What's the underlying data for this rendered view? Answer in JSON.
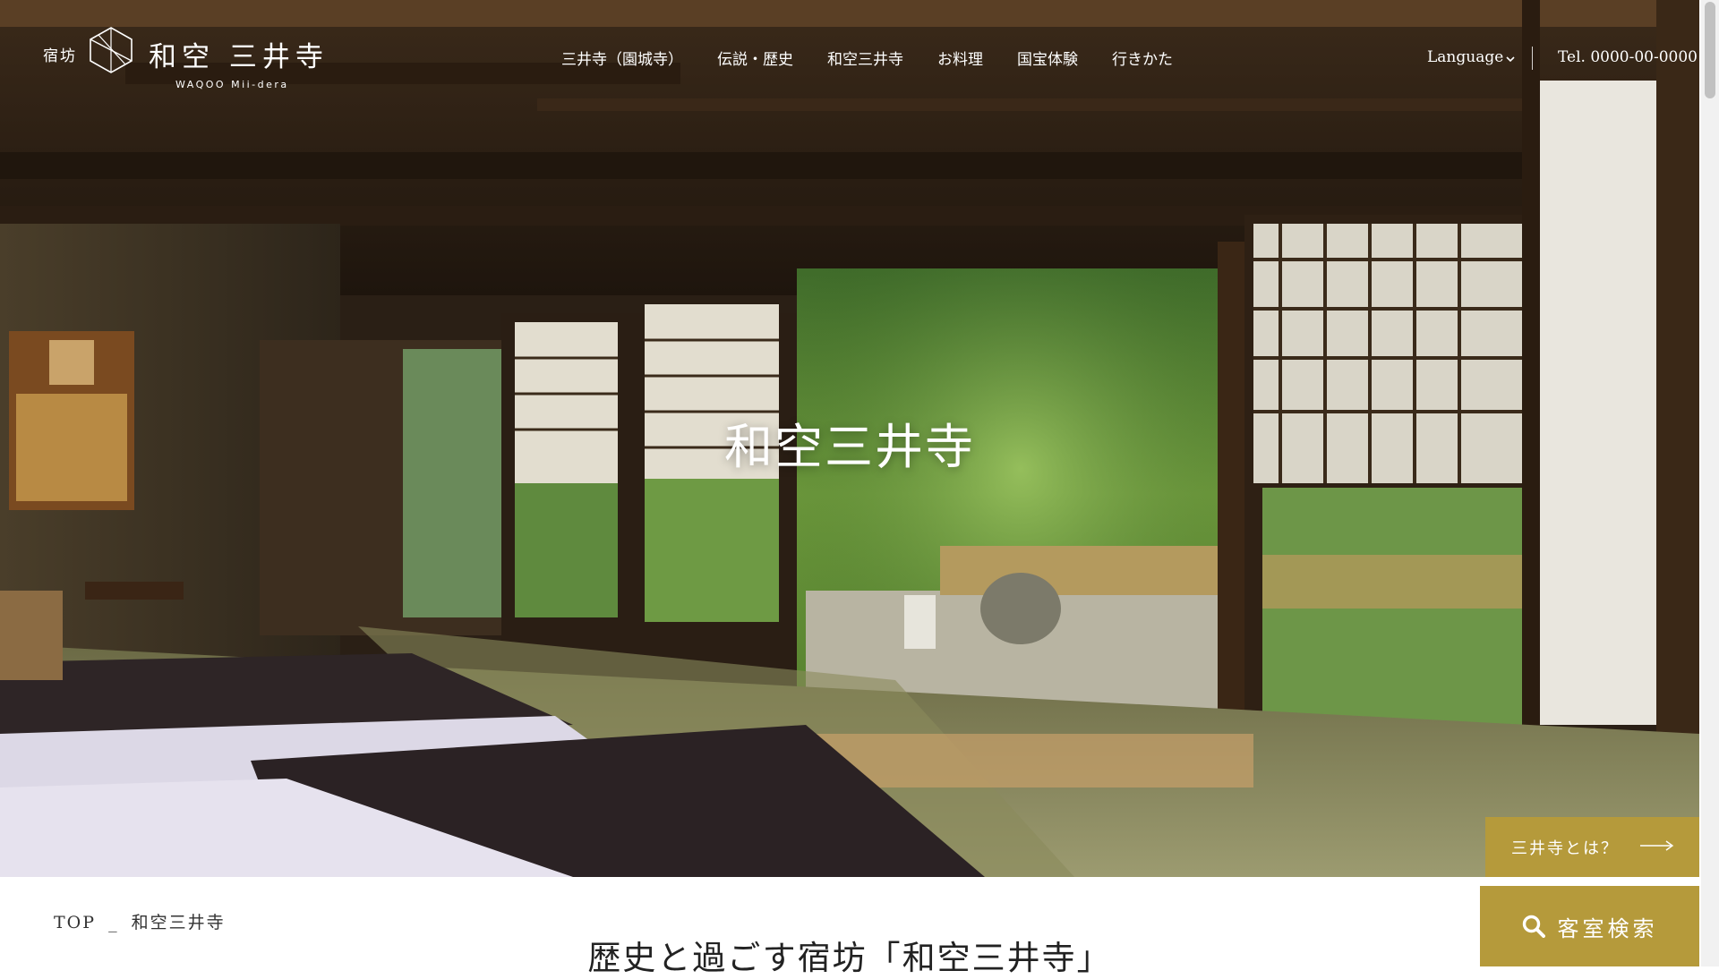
{
  "header": {
    "logo_prefix": "宿坊",
    "logo_name": "和空 三井寺",
    "logo_sub": "WAQOO Mii-dera",
    "nav": [
      {
        "label": "三井寺（園城寺）"
      },
      {
        "label": "伝説・歴史"
      },
      {
        "label": "和空三井寺"
      },
      {
        "label": "お料理"
      },
      {
        "label": "国宝体験"
      },
      {
        "label": "行きかた"
      }
    ],
    "language_label": "Language",
    "tel": "Tel. 0000-00-0000"
  },
  "hero": {
    "title": "和空三井寺"
  },
  "floating": {
    "about_label": "三井寺とは？",
    "search_label": "客室検索"
  },
  "breadcrumb": {
    "top": "TOP",
    "separator": "_",
    "current": "和空三井寺"
  },
  "section": {
    "title": "歴史と過ごす宿坊「和空三井寺」"
  },
  "colors": {
    "accent_gold": "#b59a3b",
    "text_dark": "#222222"
  }
}
